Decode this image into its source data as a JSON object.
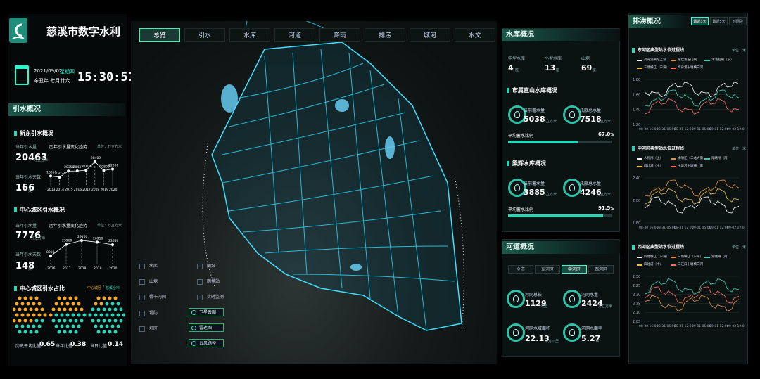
{
  "header": {
    "title": "慈溪市数字水利",
    "date": "2021/09/02",
    "weekday": "星期四",
    "lunar": "辛丑年 七月廿六",
    "time": "15:30:51"
  },
  "yinshui": {
    "title": "引水概况",
    "dongxin": {
      "title": "新东引水概况",
      "year_label": "当年引水量",
      "trend_label": "历年引水量变化趋势",
      "unit_label": "单位：万立方米",
      "volume": "20463",
      "volume_unit": "万立方米",
      "days_label": "当年引水天数",
      "days": "166",
      "days_unit": "天",
      "years": [
        "2013",
        "2014",
        "2015",
        "2016",
        "2017",
        "2018",
        "2019",
        "2020"
      ],
      "values": [
        "16050",
        "15024",
        "20350",
        "20437",
        "21020",
        "28409",
        "20890",
        "22000"
      ]
    },
    "center": {
      "title": "中心城区引水概况",
      "year_label": "当年引水量",
      "trend_label": "历年引水量变化趋势",
      "unit_label": "单位：万立方米",
      "volume": "7776",
      "volume_unit": "万立方米",
      "days_label": "当年引水天数",
      "days": "148",
      "days_unit": "天",
      "years": [
        "2016",
        "2017",
        "2018",
        "2019",
        "2020"
      ],
      "values": [
        "8930",
        "23960",
        "29160",
        "26950",
        "23650"
      ]
    },
    "ratio": {
      "title": "中心城区引水占比",
      "legend_a": "中心城区",
      "legend_sep": "/",
      "legend_b": "慈溪全市",
      "items": [
        {
          "label": "历史平均比值",
          "value": "0.65"
        },
        {
          "label": "当年比值",
          "value": "0.38"
        },
        {
          "label": "当日比值",
          "value": "0.14"
        }
      ]
    }
  },
  "nav": [
    "总览",
    "引水",
    "水库",
    "河道",
    "降雨",
    "排涝",
    "城河",
    "水文"
  ],
  "nav_active": 0,
  "map_legend": {
    "left": [
      "水库",
      "山塘",
      "骨干河网",
      "堤防",
      "圩区"
    ],
    "right": [
      "闸泵",
      "雨量站",
      "实时监测"
    ],
    "buttons": [
      "卫星云图",
      "雷达图",
      "台风路径"
    ]
  },
  "reservoir": {
    "title": "水库概况",
    "types": [
      {
        "label": "中型水库",
        "value": "4",
        "unit": "座"
      },
      {
        "label": "小型水库",
        "value": "13",
        "unit": "座"
      },
      {
        "label": "山塘",
        "value": "69",
        "unit": "座"
      }
    ],
    "a": {
      "title": "市属直山水库概况",
      "cur_label": "当前蓄水量",
      "cur": "5038",
      "cur_unit": "万立方米",
      "flood_label": "汛限总水量",
      "flood": "7518",
      "flood_unit": "万立方米",
      "ratio_label": "平均蓄水比例",
      "ratio": "67.0",
      "ratio_unit": "%",
      "ratio_value": 0.67
    },
    "b": {
      "title": "梁辉水库概况",
      "cur_label": "当前蓄水量",
      "cur": "3885",
      "cur_unit": "万立方米",
      "flood_label": "汛限总水量",
      "flood": "4246",
      "flood_unit": "万立方米",
      "ratio_label": "平均蓄水比例",
      "ratio": "91.5",
      "ratio_unit": "%",
      "ratio_value": 0.915
    }
  },
  "river": {
    "title": "河道概况",
    "tabs": [
      "全市",
      "东河区",
      "中河区",
      "西河区"
    ],
    "active_tab": 2,
    "stats": [
      {
        "label": "河网总长",
        "value": "1129",
        "unit": "公里"
      },
      {
        "label": "河网水量",
        "value": "2424",
        "unit": "万立方米"
      },
      {
        "label": "河网水域面积",
        "value": "22.13",
        "unit": "平方公里"
      },
      {
        "label": "河网水面率",
        "value": "5.27",
        "unit": "%"
      }
    ]
  },
  "drain": {
    "title": "排涝概况",
    "tabs": [
      "最近3天",
      "最近5天",
      "时间段"
    ],
    "active_tab": 0,
    "charts": [
      {
        "title": "东河区典型站水位过程线",
        "unit": "单位：米",
        "legend": [
          "高背浦闸站上游",
          "东仕浦五门闸",
          "洋浦船闸（东）",
          "三塘横江（宁海）",
          "高背浦十塘横向河"
        ],
        "yticks": [
          "1.80",
          "1.60",
          "1.40",
          "1.20"
        ],
        "xticks": [
          "08-30 16:00",
          "08-31 05:00",
          "08-31 12:00",
          "09-01 05:00",
          "09-01 12:00",
          "09-02 12:00"
        ]
      },
      {
        "title": "中河区典型站水位过程线",
        "unit": "单位：米",
        "legend": [
          "人民闸（上）",
          "虎啸江（三北大街）",
          "潮塘闸（南）",
          "四灶浦（中）",
          "中塘河十塘横（南）"
        ],
        "yticks": [
          "2.40",
          "2.00",
          "1.60"
        ],
        "xticks": [
          "08-30 16:00",
          "08-31 05:00",
          "08-31 12:00",
          "09-01 05:00",
          "09-01 12:00",
          "09-02 12:00"
        ]
      },
      {
        "title": "西河区典型站水位过程线",
        "unit": "单位：米",
        "legend": [
          "四塘横江（宁海）",
          "三塘横江（宁海）",
          "潮塘闸（南）",
          "四灶浦（中）",
          "三江口十塘横向河"
        ],
        "yticks": [
          "2.30",
          "2.25",
          "2.20",
          "2.15",
          "2.10",
          "2.05"
        ],
        "xticks": [
          "08-30 16:00",
          "08-31 05:00",
          "08-31 12:00",
          "09-01 05:00",
          "09-01 12:00",
          "09-02 12:00"
        ]
      }
    ]
  }
}
